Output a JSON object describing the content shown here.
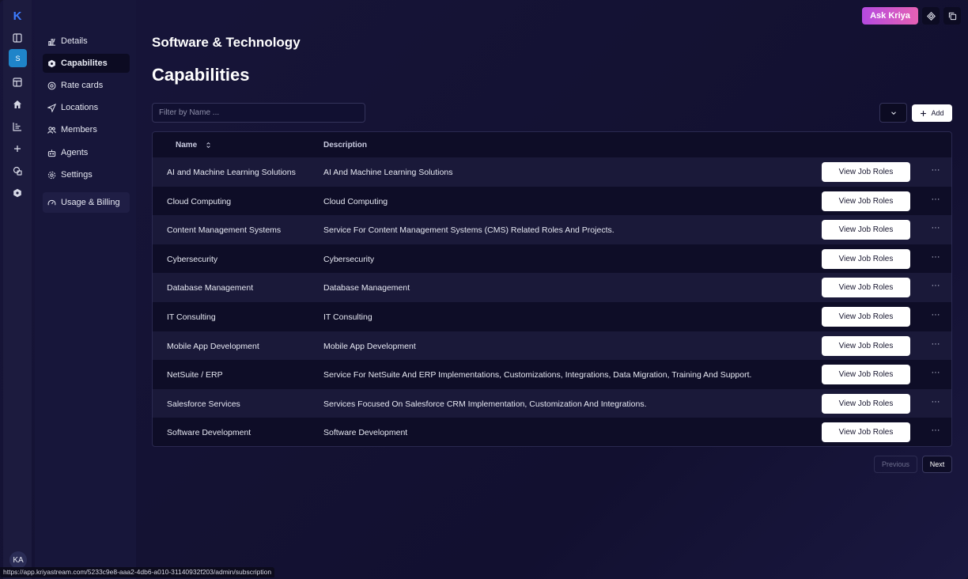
{
  "rail": {
    "logo": "K",
    "workspace_initial": "S",
    "avatar_initials": "KA",
    "icons": [
      "panel-icon",
      "board-icon",
      "home-icon",
      "analytics-icon",
      "plus-icon",
      "shapes-icon",
      "hexagon-icon"
    ]
  },
  "subnav": {
    "items": [
      {
        "label": "Details",
        "icon": "chart-icon"
      },
      {
        "label": "Capabilites",
        "icon": "hexagon-icon"
      },
      {
        "label": "Rate cards",
        "icon": "gauge-icon"
      },
      {
        "label": "Locations",
        "icon": "navigation-icon"
      },
      {
        "label": "Members",
        "icon": "users-icon"
      },
      {
        "label": "Agents",
        "icon": "bot-icon"
      },
      {
        "label": "Settings",
        "icon": "gear-icon"
      }
    ],
    "billing": {
      "label": "Usage & Billing",
      "icon": "speedometer-icon"
    }
  },
  "header": {
    "org_name": "Software & Technology",
    "title": "Capabilities",
    "ask_label": "Ask Kriya"
  },
  "filter": {
    "placeholder": "Filter by Name ...",
    "value": ""
  },
  "toolbar": {
    "add_label": "Add"
  },
  "table": {
    "columns": {
      "name": "Name",
      "description": "Description"
    },
    "action_label": "View Job Roles",
    "more_label": "···",
    "rows": [
      {
        "name": "AI and Machine Learning Solutions",
        "description": "AI And Machine Learning Solutions"
      },
      {
        "name": "Cloud Computing",
        "description": "Cloud Computing"
      },
      {
        "name": "Content Management Systems",
        "description": "Service For Content Management Systems (CMS) Related Roles And Projects."
      },
      {
        "name": "Cybersecurity",
        "description": "Cybersecurity"
      },
      {
        "name": "Database Management",
        "description": "Database Management"
      },
      {
        "name": "IT Consulting",
        "description": "IT Consulting"
      },
      {
        "name": "Mobile App Development",
        "description": "Mobile App Development"
      },
      {
        "name": "NetSuite / ERP",
        "description": "Service For NetSuite And ERP Implementations, Customizations, Integrations, Data Migration, Training And Support."
      },
      {
        "name": "Salesforce Services",
        "description": "Services Focused On Salesforce CRM Implementation, Customization And Integrations."
      },
      {
        "name": "Software Development",
        "description": "Software Development"
      }
    ]
  },
  "pagination": {
    "previous": "Previous",
    "next": "Next"
  },
  "status_bar": {
    "url": "https://app.kriyastream.com/5233c9e8-aaa2-4db6-a010-31140932f203/admin/subscription"
  }
}
